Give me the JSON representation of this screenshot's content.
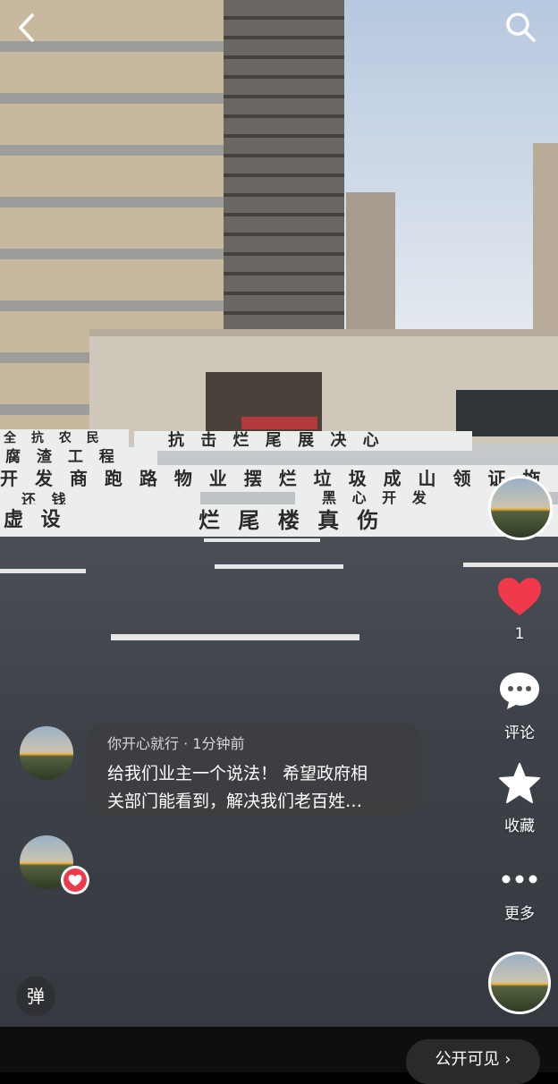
{
  "header": {
    "back_icon": "chevron-left-icon",
    "search_icon": "search-icon"
  },
  "video": {
    "banners": [
      "全 抗 农 民",
      "抗 击 烂 尾 展 决 心",
      "腐 渣 工 程",
      "开 发 商 跑 路   物 业 摆 烂   垃 圾 成 山   领 证 拖",
      "还 钱",
      "黑 心 开 发",
      "虚 设",
      "烂 尾 楼 真 伤"
    ]
  },
  "side_actions": {
    "like_count": "1",
    "comment_label": "评论",
    "favorite_label": "收藏",
    "more_label": "更多"
  },
  "comment": {
    "author": "你开心就行",
    "time": "· 1分钟前",
    "text_line1": "给我们业主一个说法！ 希望政府相",
    "text_line2": "关部门能看到，解决我们老百姓…"
  },
  "danmu_label": "弹",
  "footer": {
    "public_label": "公开可见 ›"
  },
  "colors": {
    "like": "#f03a4c",
    "text": "#ffffff"
  }
}
